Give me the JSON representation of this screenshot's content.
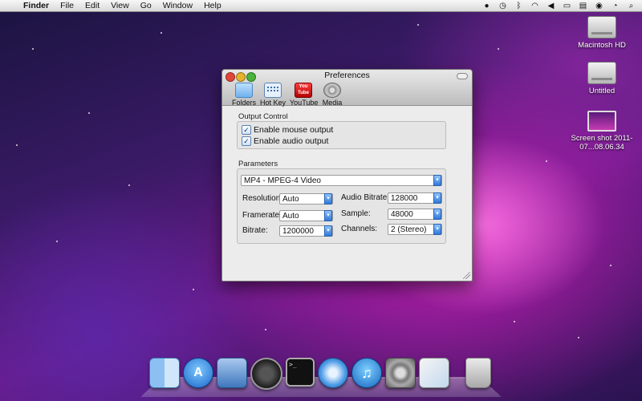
{
  "menubar": {
    "app_name": "Finder",
    "menus": [
      "File",
      "Edit",
      "View",
      "Go",
      "Window",
      "Help"
    ]
  },
  "desktop_icons": [
    {
      "label": "Macintosh HD",
      "icon": "hard-drive-icon"
    },
    {
      "label": "Untitled",
      "icon": "hard-drive-icon"
    },
    {
      "label": "Screen shot 2011-07...08.06.34",
      "icon": "screenshot-icon"
    }
  ],
  "window": {
    "title": "Preferences",
    "toolbar": [
      "Folders",
      "Hot Key",
      "YouTube",
      "Media"
    ],
    "youtube_icon_text": {
      "top": "You",
      "bottom": "Tube"
    },
    "output_control": {
      "label": "Output Control",
      "options": [
        {
          "label": "Enable mouse output",
          "checked": true
        },
        {
          "label": "Enable audio output",
          "checked": true
        }
      ]
    },
    "parameters": {
      "label": "Parameters",
      "format": "MP4 - MPEG-4 Video",
      "resolution": {
        "label": "Resolution:",
        "value": "Auto"
      },
      "framerate": {
        "label": "Framerate:",
        "value": "Auto"
      },
      "bitrate": {
        "label": "Bitrate:",
        "value": "1200000"
      },
      "audio_bitrate": {
        "label": "Audio Bitrate:",
        "value": "128000"
      },
      "sample": {
        "label": "Sample:",
        "value": "48000"
      },
      "channels": {
        "label": "Channels:",
        "value": "2 (Stereo)"
      }
    }
  },
  "dock": [
    "finder",
    "app-store",
    "xcode",
    "dashboard",
    "terminal",
    "safari",
    "itunes",
    "system-preferences",
    "preview",
    "trash"
  ],
  "colors": {
    "accent": "#2f79d8",
    "close": "#e2463b",
    "minimize": "#e8b22b",
    "zoom": "#49b33a"
  }
}
